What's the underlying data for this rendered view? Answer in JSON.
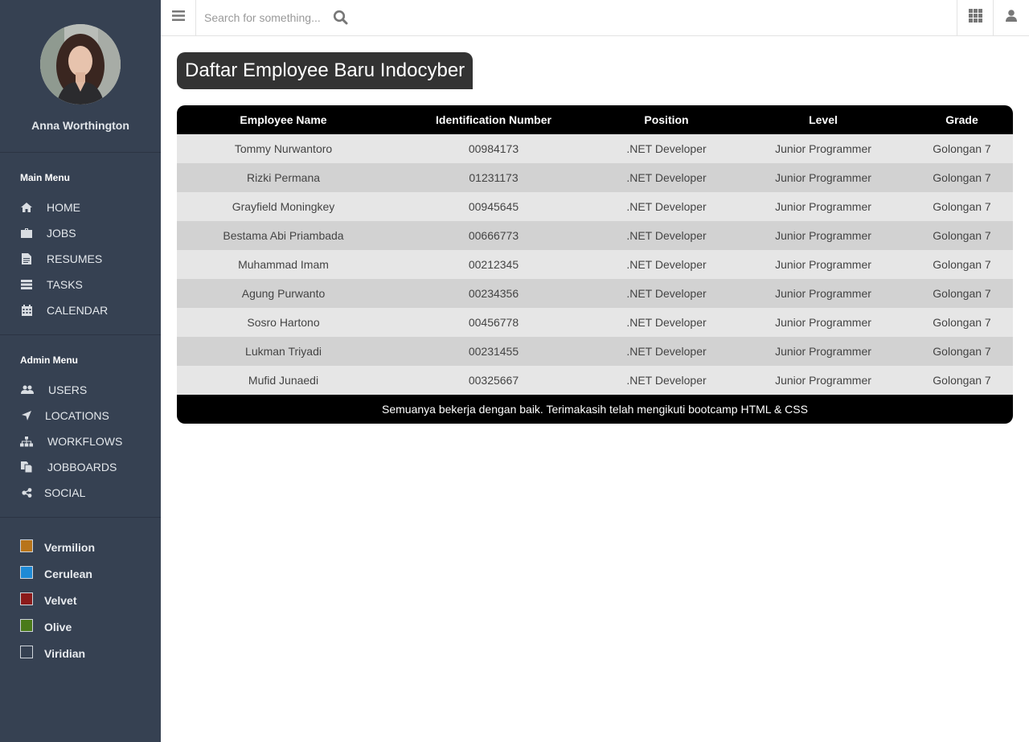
{
  "profile": {
    "name": "Anna Worthington"
  },
  "main_menu": {
    "title": "Main Menu",
    "items": [
      {
        "label": "HOME",
        "icon": "home-icon"
      },
      {
        "label": "JOBS",
        "icon": "briefcase-icon"
      },
      {
        "label": "RESUMES",
        "icon": "file-icon"
      },
      {
        "label": "TASKS",
        "icon": "tasks-icon"
      },
      {
        "label": "CALENDAR",
        "icon": "calendar-icon"
      }
    ]
  },
  "admin_menu": {
    "title": "Admin Menu",
    "items": [
      {
        "label": "USERS",
        "icon": "users-icon"
      },
      {
        "label": "LOCATIONS",
        "icon": "location-arrow-icon"
      },
      {
        "label": "WORKFLOWS",
        "icon": "sitemap-icon"
      },
      {
        "label": "JOBBOARDS",
        "icon": "copy-icon"
      },
      {
        "label": "SOCIAL",
        "icon": "share-icon"
      }
    ]
  },
  "color_themes": [
    {
      "label": "Vermilion",
      "color": "#b8741a"
    },
    {
      "label": "Cerulean",
      "color": "#1e8ad6"
    },
    {
      "label": "Velvet",
      "color": "#8b1a1a"
    },
    {
      "label": "Olive",
      "color": "#4a7a1a"
    },
    {
      "label": "Viridian",
      "color": "#364152"
    }
  ],
  "topbar": {
    "search_placeholder": "Search for something..."
  },
  "page_title": "Daftar Employee Baru Indocyber",
  "table": {
    "headers": [
      "Employee Name",
      "Identification Number",
      "Position",
      "Level",
      "Grade"
    ],
    "rows": [
      [
        "Tommy Nurwantoro",
        "00984173",
        ".NET Developer",
        "Junior Programmer",
        "Golongan 7"
      ],
      [
        "Rizki Permana",
        "01231173",
        ".NET Developer",
        "Junior Programmer",
        "Golongan 7"
      ],
      [
        "Grayfield Moningkey",
        "00945645",
        ".NET Developer",
        "Junior Programmer",
        "Golongan 7"
      ],
      [
        "Bestama Abi Priambada",
        "00666773",
        ".NET Developer",
        "Junior Programmer",
        "Golongan 7"
      ],
      [
        "Muhammad Imam",
        "00212345",
        ".NET Developer",
        "Junior Programmer",
        "Golongan 7"
      ],
      [
        "Agung Purwanto",
        "00234356",
        ".NET Developer",
        "Junior Programmer",
        "Golongan 7"
      ],
      [
        "Sosro Hartono",
        "00456778",
        ".NET Developer",
        "Junior Programmer",
        "Golongan 7"
      ],
      [
        "Lukman Triyadi",
        "00231455",
        ".NET Developer",
        "Junior Programmer",
        "Golongan 7"
      ],
      [
        "Mufid Junaedi",
        "00325667",
        ".NET Developer",
        "Junior Programmer",
        "Golongan 7"
      ]
    ],
    "footer": "Semuanya bekerja dengan baik. Terimakasih telah mengikuti bootcamp HTML & CSS"
  }
}
